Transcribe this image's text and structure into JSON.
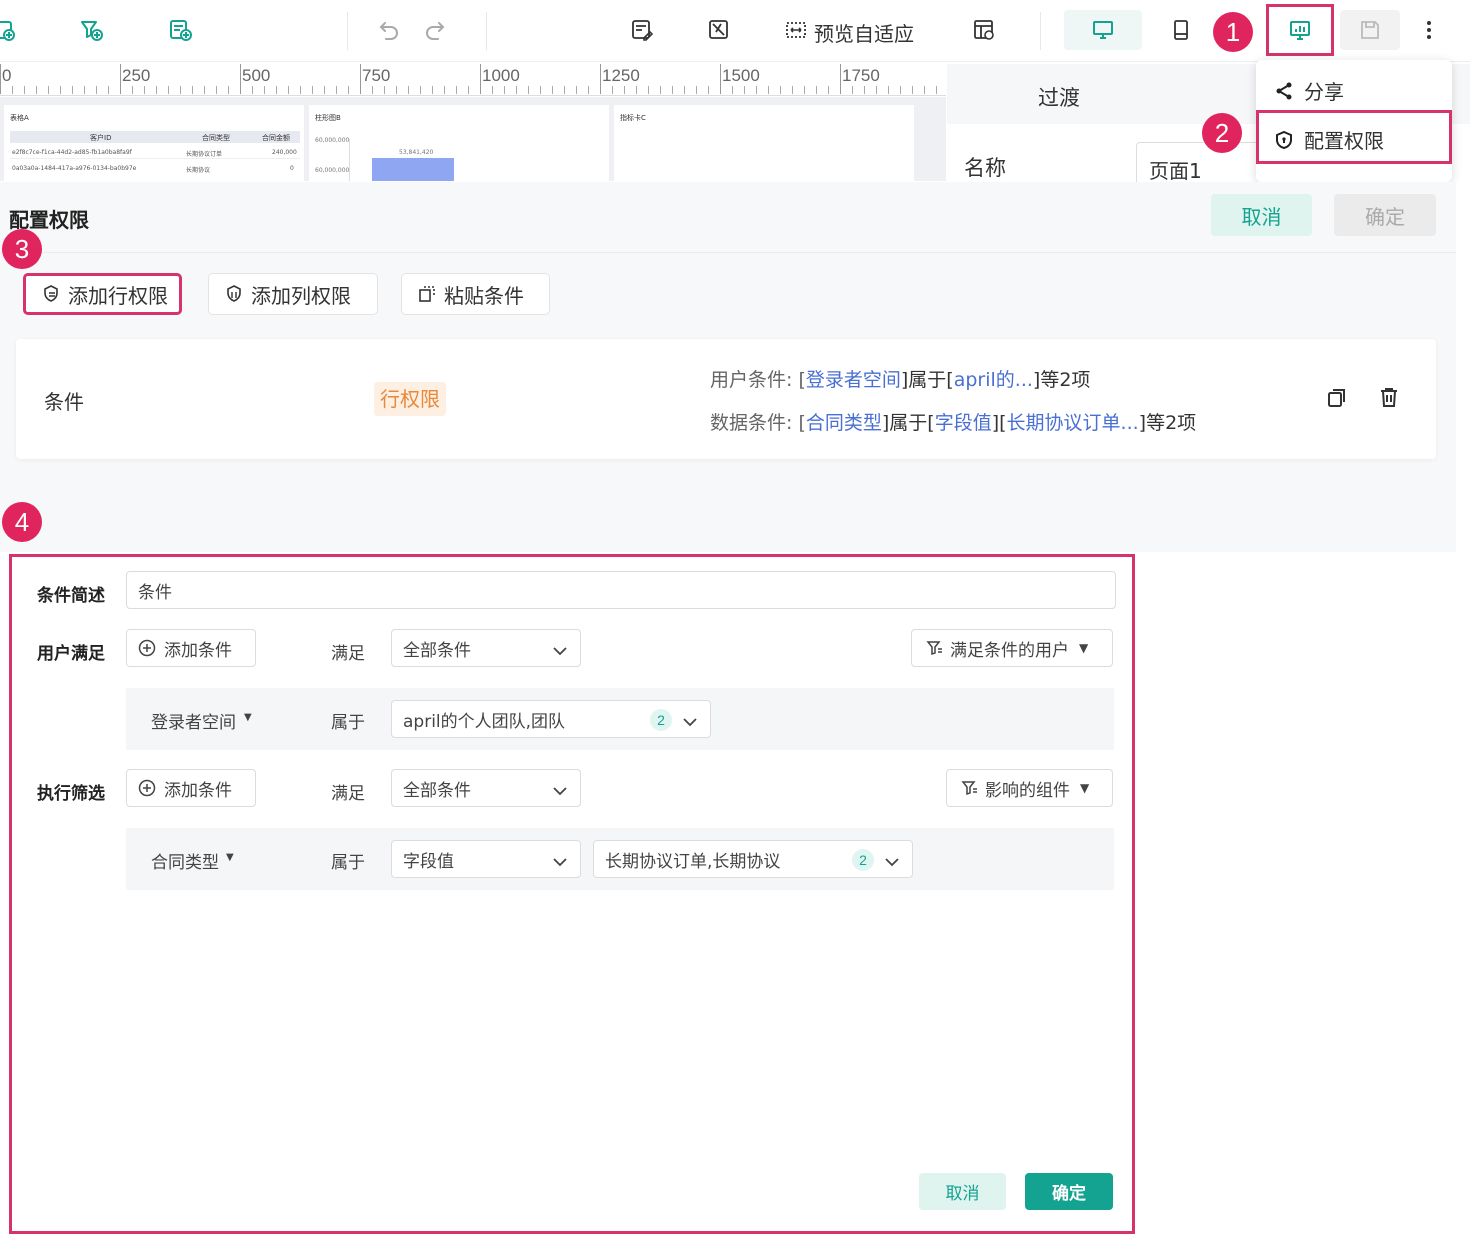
{
  "toolbar": {
    "preview_adaptive_label": "预览自适应",
    "badge_1": "1"
  },
  "ruler": {
    "labels": [
      "0",
      "250",
      "500",
      "750",
      "1000",
      "1250",
      "1500",
      "1750"
    ]
  },
  "canvas": {
    "card_a": {
      "title": "表格A",
      "headers": [
        "客户ID",
        "合同类型",
        "合同金额"
      ],
      "rows": [
        [
          "e2f8c7ce-f1ca-44d2-ad85-fb1a0ba8fa9f",
          "长期协议订单",
          "240,000"
        ],
        [
          "0a03a0a-1484-417a-a976-0134-ba0b97e",
          "长期协议",
          "0"
        ]
      ]
    },
    "card_b": {
      "title": "柱形图B",
      "y_labels": [
        "60,000,000",
        "60,000,000"
      ],
      "bar_label": "53,841,420"
    },
    "card_c": {
      "title": "指标卡C"
    }
  },
  "right_panel": {
    "tab_transition": "过渡",
    "name_label": "名称",
    "name_value": "页面1"
  },
  "dropdown": {
    "share_label": "分享",
    "config_label": "配置权限",
    "badge_2": "2"
  },
  "perm_panel": {
    "title": "配置权限",
    "cancel_label": "取消",
    "confirm_label": "确定",
    "badge_3": "3",
    "add_row_label": "添加行权限",
    "add_col_label": "添加列权限",
    "paste_label": "粘贴条件",
    "condition_card": {
      "name": "条件",
      "tag": "行权限",
      "user_prefix": "用户条件: [",
      "user_field": "登录者空间",
      "user_mid": "]属于[",
      "user_value": "april的...",
      "user_suffix": "]等2项",
      "data_prefix": "数据条件: [",
      "data_field": "合同类型",
      "data_mid": "]属于[",
      "data_value1": "字段值",
      "data_mid2": "][",
      "data_value2": "长期协议订单...",
      "data_suffix": "]等2项"
    },
    "badge_4": "4"
  },
  "editor": {
    "desc_label": "条件简述",
    "desc_value": "条件",
    "user_label": "用户满足",
    "add_cond_label": "添加条件",
    "meet_label": "满足",
    "all_cond": "全部条件",
    "user_filter_btn": "满足条件的用户",
    "user_row_field": "登录者空间",
    "belongs_label": "属于",
    "user_row_value": "april的个人团队,团队",
    "user_row_count": "2",
    "exec_label": "执行筛选",
    "exec_add_cond_label": "添加条件",
    "exec_meet_label": "满足",
    "exec_all_cond": "全部条件",
    "affected_btn": "影响的组件",
    "exec_row_field": "合同类型",
    "exec_belongs_label": "属于",
    "exec_row_type": "字段值",
    "exec_row_value": "长期协议订单,长期协议",
    "exec_row_count": "2",
    "cancel_label": "取消",
    "confirm_label": "确定"
  },
  "colors": {
    "accent_teal": "#14a390",
    "highlight_pink": "#d6336c",
    "badge_red": "#e0245e",
    "link_blue": "#4a6fd4",
    "tag_orange": "#e8883a"
  }
}
